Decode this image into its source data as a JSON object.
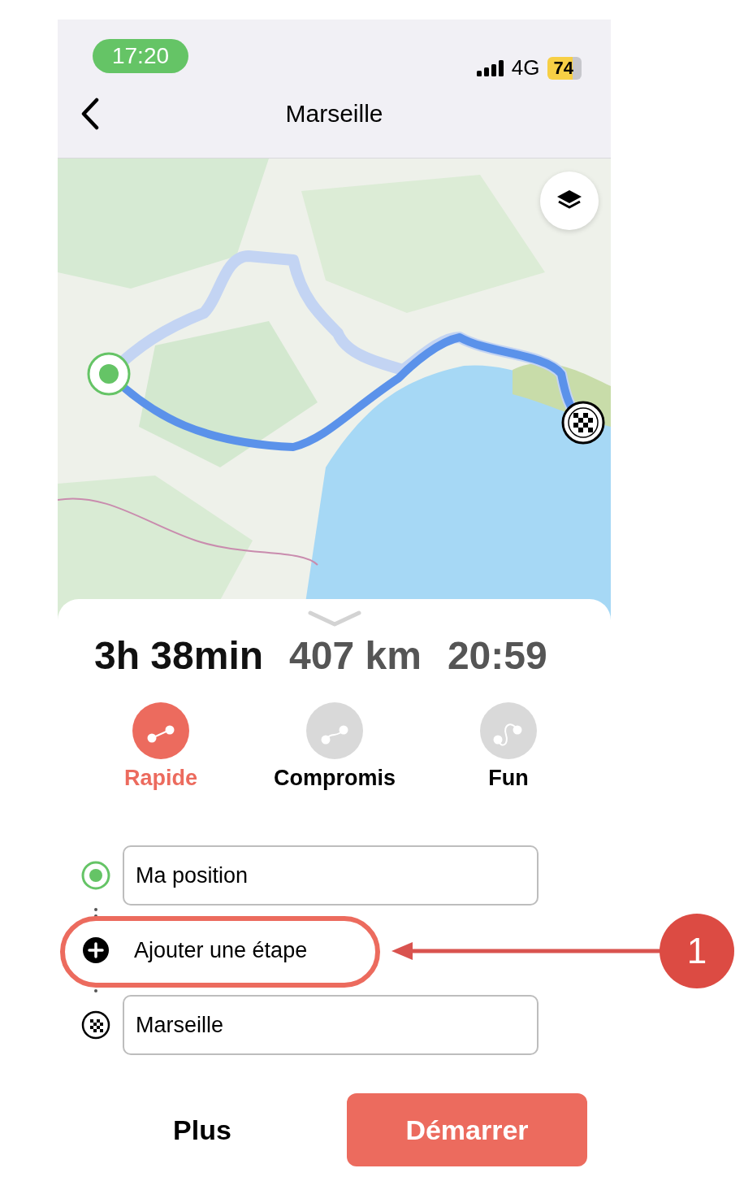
{
  "status_bar": {
    "time": "17:20",
    "network": "4G",
    "battery": "74"
  },
  "header": {
    "title": "Marseille"
  },
  "summary": {
    "duration": "3h 38min",
    "distance": "407 km",
    "arrival": "20:59"
  },
  "route_modes": [
    {
      "label": "Rapide",
      "kind": "straight",
      "selected": true
    },
    {
      "label": "Compromis",
      "kind": "wavy",
      "selected": false
    },
    {
      "label": "Fun",
      "kind": "loop",
      "selected": false
    }
  ],
  "stops": [
    {
      "kind": "origin",
      "value": "Ma position"
    },
    {
      "kind": "waypoint",
      "label": "Ajouter une étape"
    },
    {
      "kind": "destination",
      "value": "Marseille"
    }
  ],
  "actions": {
    "more": "Plus",
    "start": "Démarrer"
  },
  "annotation": {
    "number": "1"
  }
}
